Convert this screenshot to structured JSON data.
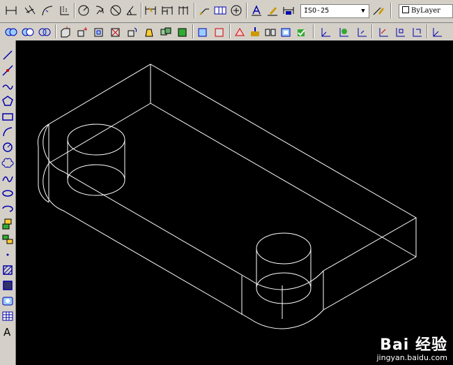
{
  "toolbar_top": {
    "dimstyle_value": "ISO-25",
    "layer_value": "ByLayer"
  },
  "watermark": {
    "brand": "Bai 经验",
    "url": "jingyan.baidu.com"
  },
  "icons": {
    "top": [
      "linear-dim-icon",
      "aligned-dim-icon",
      "arc-length-icon",
      "ordinate-dim-icon",
      "radius-dim-icon",
      "jogged-dim-icon",
      "diameter-dim-icon",
      "angular-dim-icon",
      "quick-dim-icon",
      "baseline-dim-icon",
      "continue-dim-icon",
      "leader-icon",
      "tolerance-icon",
      "center-mark-icon",
      "dim-edit-icon",
      "dim-text-edit-icon",
      "dim-update-icon",
      "dimstyle-icon"
    ],
    "second": [
      "union-icon",
      "subtract-icon",
      "intersect-icon",
      "extrude-faces-icon",
      "move-faces-icon",
      "offset-faces-icon",
      "delete-faces-icon",
      "rotate-faces-icon",
      "taper-faces-icon",
      "copy-faces-icon",
      "color-faces-icon",
      "copy-edges-icon",
      "color-edges-icon",
      "imprint-icon",
      "clean-icon",
      "separate-icon",
      "shell-icon",
      "check-icon",
      "ucs-icon",
      "ucs-world-icon",
      "ucs-previous-icon",
      "ucs-face-icon",
      "ucs-object-icon",
      "ucs-view-icon"
    ],
    "left": [
      "line-icon",
      "construction-line-icon",
      "polyline-icon",
      "polygon-icon",
      "rectangle-icon",
      "arc-icon",
      "circle-icon",
      "revision-cloud-icon",
      "spline-icon",
      "ellipse-icon",
      "ellipse-arc-icon",
      "insert-block-icon",
      "make-block-icon",
      "point-icon",
      "hatch-icon",
      "gradient-icon",
      "region-icon",
      "table-icon",
      "mtext-icon"
    ]
  },
  "colors": {
    "toolbar_bg": "#d4d0c8",
    "canvas_bg": "#000000",
    "wireframe": "#ffffff"
  }
}
